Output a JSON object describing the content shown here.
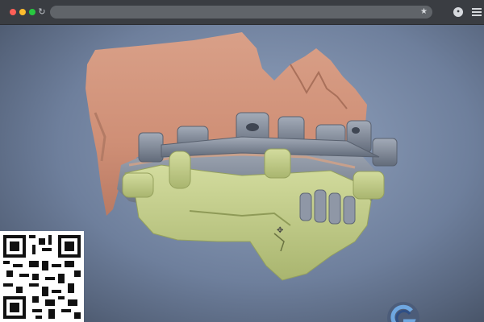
{
  "browser": {
    "window_controls": [
      "close",
      "minimize",
      "maximize"
    ],
    "url": "",
    "icons": {
      "reload": "reload-icon",
      "bookmark": "star-icon",
      "profile": "profile-icon",
      "menu": "hamburger-menu-icon"
    }
  },
  "viewport": {
    "scene": "3d-dental-surgical-guide-model",
    "colors": {
      "jaw_bone": "#d7997f",
      "guide": "#c9d490",
      "sleeves": "#7d8797",
      "background": "#7f90ac"
    }
  },
  "overlays": {
    "qr_code": "qr-code",
    "logo": "g-logo-icon"
  }
}
